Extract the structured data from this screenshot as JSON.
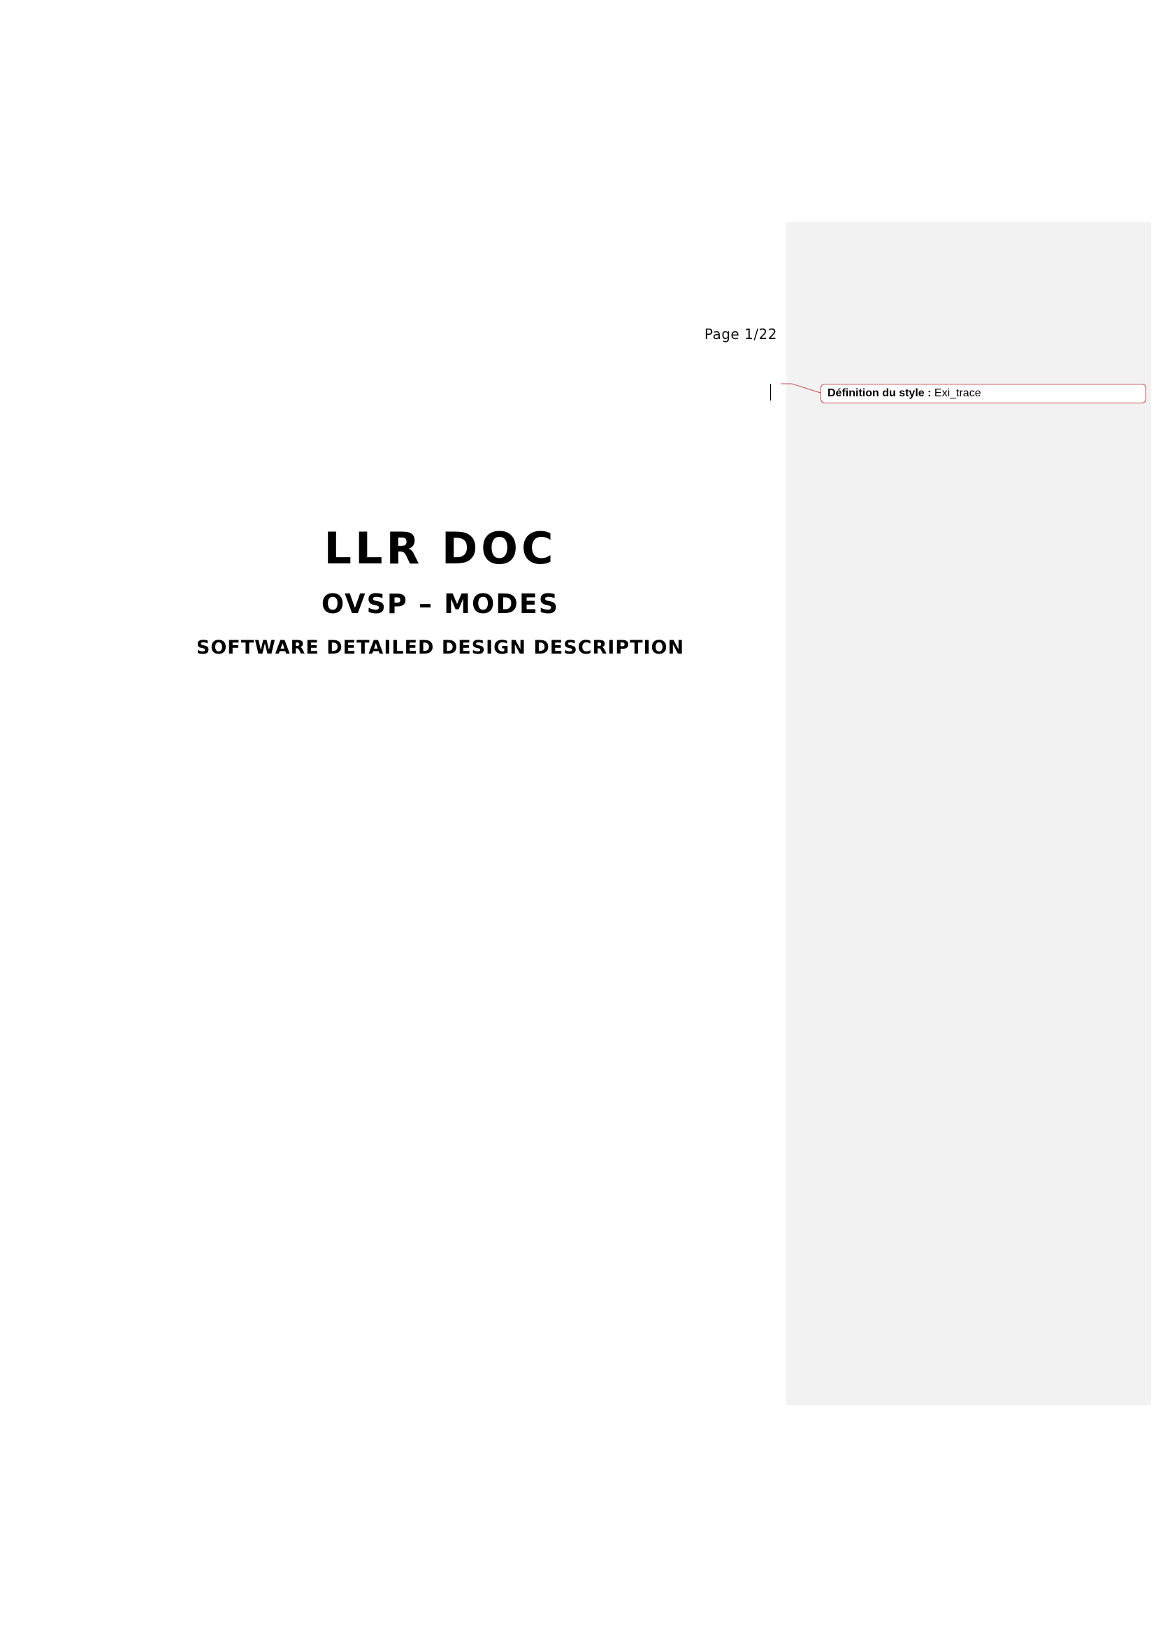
{
  "header": {
    "page_number": "Page 1/22"
  },
  "comment": {
    "label": "Définition du style :",
    "value": "Exi_trace",
    "border_color": "#c0504d",
    "pane_color": "#f2f2f2"
  },
  "cover": {
    "title": "LLR DOC",
    "subtitle": "OVSP – MODES",
    "description": "SOFTWARE DETAILED DESIGN DESCRIPTION"
  }
}
